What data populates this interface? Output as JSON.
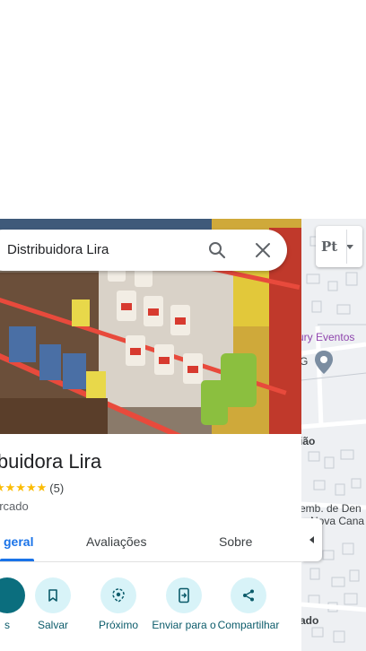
{
  "search": {
    "query": "Distribuidora Lira"
  },
  "place": {
    "name": "ibuidora Lira",
    "rating_count": "(5)",
    "category": "ercado"
  },
  "tabs": [
    {
      "label": "geral",
      "active": true
    },
    {
      "label": "Avaliações",
      "active": false
    },
    {
      "label": "Sobre",
      "active": false
    }
  ],
  "actions": [
    {
      "label": "s",
      "icon": "directions-icon"
    },
    {
      "label": "Salvar",
      "icon": "bookmark-icon"
    },
    {
      "label": "Próximo",
      "icon": "nearby-icon"
    },
    {
      "label": "Enviar para o",
      "icon": "send-to-phone-icon"
    },
    {
      "label": "Compartilhar",
      "icon": "share-icon"
    }
  ],
  "map": {
    "layer_label": "Pt",
    "labels": {
      "eventos": "ury Eventos",
      "g": "G",
      "uiao": "ião",
      "dem": "emb. de Den",
      "nova": "Nova Cana",
      "ado": "ado"
    }
  },
  "colors": {
    "accent": "#1a73e8",
    "action_bg": "#d8f3f8",
    "action_primary": "#0b6e7e",
    "star": "#fbbc04"
  }
}
